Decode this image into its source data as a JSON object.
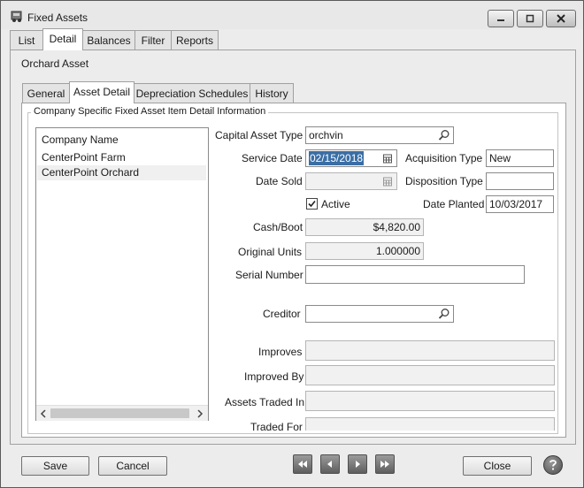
{
  "window": {
    "title": "Fixed Assets"
  },
  "main_tabs": [
    "List",
    "Detail",
    "Balances",
    "Filter",
    "Reports"
  ],
  "asset_name": "Orchard Asset",
  "sub_tabs": [
    "General",
    "Asset Detail",
    "Depreciation Schedules",
    "History"
  ],
  "group_title": "Company Specific Fixed Asset Item Detail Information",
  "company_list": {
    "header": "Company Name",
    "items": [
      "CenterPoint Farm",
      "CenterPoint Orchard"
    ]
  },
  "fields": {
    "capital_asset_type": {
      "label": "Capital Asset Type",
      "value": "orchvin"
    },
    "service_date": {
      "label": "Service Date",
      "value": "02/15/2018"
    },
    "acquisition_type": {
      "label": "Acquisition Type",
      "value": "New"
    },
    "date_sold": {
      "label": "Date Sold",
      "value": ""
    },
    "disposition_type": {
      "label": "Disposition Type",
      "value": ""
    },
    "active": {
      "label": "Active",
      "checked": true
    },
    "date_planted": {
      "label": "Date Planted",
      "value": "10/03/2017"
    },
    "cash_boot": {
      "label": "Cash/Boot",
      "value": "$4,820.00"
    },
    "original_units": {
      "label": "Original Units",
      "value": "1.000000"
    },
    "serial_number": {
      "label": "Serial Number",
      "value": ""
    },
    "creditor": {
      "label": "Creditor",
      "value": ""
    },
    "improves": {
      "label": "Improves",
      "value": ""
    },
    "improved_by": {
      "label": "Improved By",
      "value": ""
    },
    "assets_traded_in": {
      "label": "Assets Traded In",
      "value": ""
    },
    "traded_for": {
      "label": "Traded For",
      "value": ""
    }
  },
  "buttons": {
    "save": "Save",
    "cancel": "Cancel",
    "close": "Close"
  }
}
